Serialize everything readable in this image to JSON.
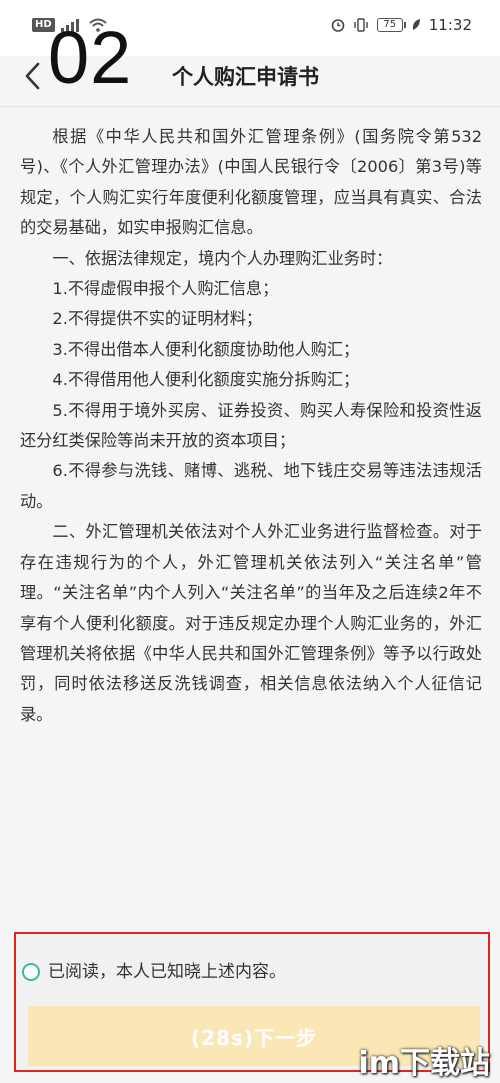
{
  "status_bar": {
    "left_badge": "HD",
    "time": "11:32",
    "battery": "75"
  },
  "header": {
    "step_number": "02",
    "title": "个人购汇申请书"
  },
  "content": {
    "paragraphs": [
      "根据《中华人民共和国外汇管理条例》(国务院令第532号)、《个人外汇管理办法》(中国人民银行令〔2006〕第3号)等规定，个人购汇实行年度便利化额度管理，应当具有真实、合法的交易基础，如实申报购汇信息。",
      "一、依据法律规定，境内个人办理购汇业务时：",
      "1.不得虚假申报个人购汇信息；",
      "2.不得提供不实的证明材料；",
      "3.不得出借本人便利化额度协助他人购汇；",
      "4.不得借用他人便利化额度实施分拆购汇；",
      "5.不得用于境外买房、证券投资、购买人寿保险和投资性返还分红类保险等尚未开放的资本项目；",
      "6.不得参与洗钱、赌博、逃税、地下钱庄交易等违法违规活动。",
      "二、外汇管理机关依法对个人外汇业务进行监督检查。对于存在违规行为的个人，外汇管理机关依法列入“关注名单”管理。“关注名单”内个人列入“关注名单”的当年及之后连续2年不享有个人便利化额度。对于违反规定办理个人购汇业务的，外汇管理机关将依据《中华人民共和国外汇管理条例》等予以行政处罚，同时依法移送反洗钱调查，相关信息依法纳入个人征信记录。"
    ]
  },
  "agreement": {
    "label": "已阅读，本人已知晓上述内容。",
    "checked": false
  },
  "next_button": {
    "label": "(28s)下一步"
  },
  "watermark": "im下载站",
  "colors": {
    "accent_teal": "#3cb8a6",
    "button_disabled": "#fbe7b6",
    "highlight_border": "#e2241e"
  }
}
